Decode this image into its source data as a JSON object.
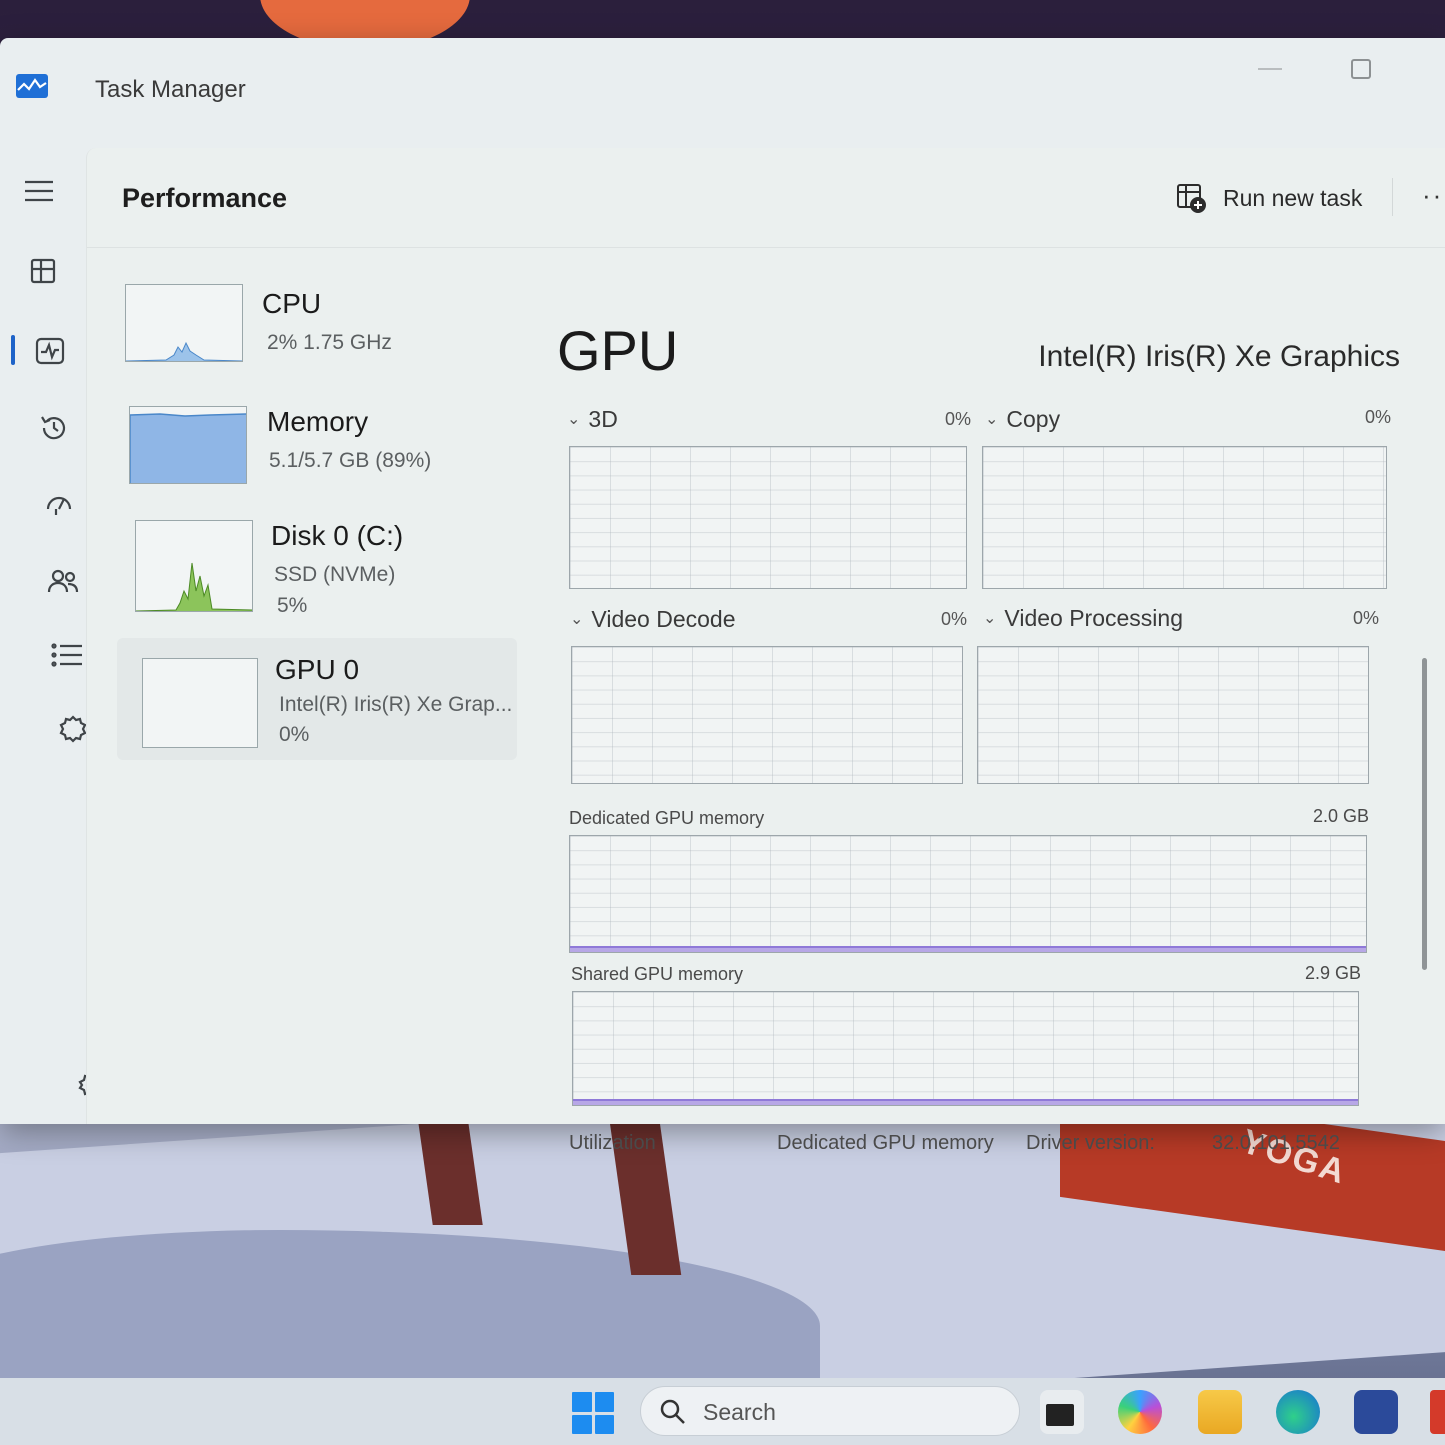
{
  "window": {
    "title": "Task Manager"
  },
  "header": {
    "page_title": "Performance",
    "run_new_task": "Run new task",
    "more": "··"
  },
  "resources": [
    {
      "name": "CPU",
      "line1": "2%  1.75 GHz",
      "line2": ""
    },
    {
      "name": "Memory",
      "line1": "5.1/5.7 GB (89%)",
      "line2": ""
    },
    {
      "name": "Disk 0 (C:)",
      "line1": "SSD (NVMe)",
      "line2": "5%"
    },
    {
      "name": "GPU 0",
      "line1": "Intel(R) Iris(R) Xe Grap...",
      "line2": "0%"
    }
  ],
  "gpu": {
    "title": "GPU",
    "model": "Intel(R) Iris(R) Xe Graphics",
    "engines": [
      {
        "label": "3D",
        "percent": "0%"
      },
      {
        "label": "Copy",
        "percent": "0%"
      },
      {
        "label": "Video Decode",
        "percent": "0%"
      },
      {
        "label": "Video Processing",
        "percent": "0%"
      }
    ],
    "dedicated_memory": {
      "label": "Dedicated GPU memory",
      "max": "2.0 GB"
    },
    "shared_memory": {
      "label": "Shared GPU memory",
      "max": "2.9 GB"
    },
    "footer": {
      "utilization": "Utilization",
      "dedicated": "Dedicated GPU memory",
      "driver_label": "Driver version:",
      "driver_value": "32.0.101.5542"
    }
  },
  "taskbar": {
    "search_placeholder": "Search"
  },
  "wallpaper": {
    "brand_text": "YOGA"
  },
  "colors": {
    "accent": "#1e63c8",
    "memory_fill": "#b7a7e6",
    "graph_border": "#9da6ab",
    "memory_thumb": "#8fb6e6",
    "disk_spike": "#6aa33a"
  }
}
